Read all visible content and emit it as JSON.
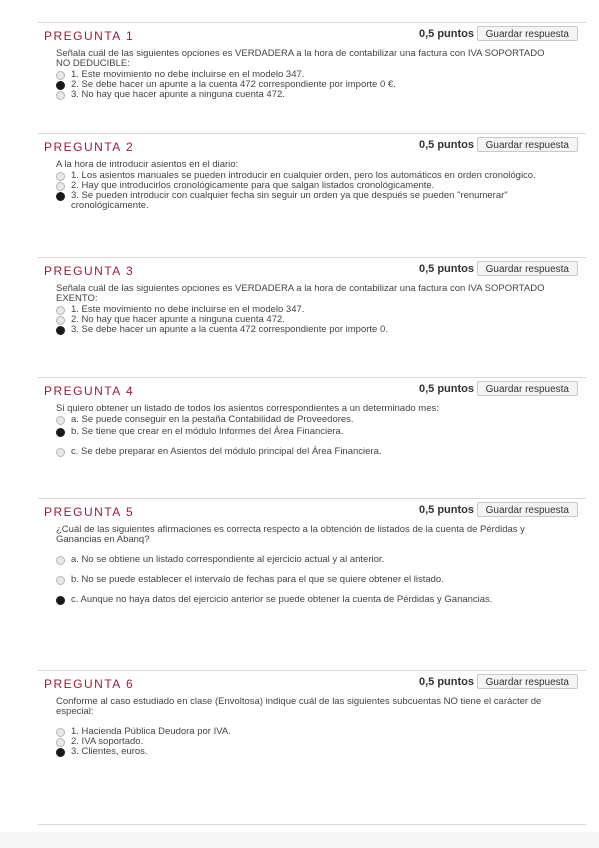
{
  "save_label": "Guardar respuesta",
  "questions": [
    {
      "title": "PREGUNTA 1",
      "points": "0,5 puntos",
      "text": "Señala cuál de las siguientes opciones es VERDADERA a la hora de contabilizar una factura con IVA SOPORTADO NO DEDUCIBLE:",
      "options": [
        {
          "label": "1. Este movimiento no debe incluirse en el modelo 347.",
          "selected": false
        },
        {
          "label": "2. Se debe hacer un apunte a la cuenta 472 correspondiente por importe 0 €.",
          "selected": true
        },
        {
          "label": "3. No hay que hacer apunte a ninguna cuenta 472.",
          "selected": false
        }
      ]
    },
    {
      "title": "PREGUNTA 2",
      "points": "0,5 puntos",
      "text": "A la hora de introducir asientos en el diario:",
      "options": [
        {
          "label": "1. Los asientos manuales se pueden introducir en cualquier orden, pero los automáticos en orden cronológico.",
          "selected": false
        },
        {
          "label": "2. Hay que introducirlos cronológicamente para que salgan listados cronológicamente.",
          "selected": false
        },
        {
          "label": "3. Se pueden introducir con cualquier fecha sin seguir un orden ya que después se pueden \"renumerar\" cronológicamente.",
          "selected": true
        }
      ]
    },
    {
      "title": "PREGUNTA 3",
      "points": "0,5 puntos",
      "text": "Señala cuál de las siguientes opciones es VERDADERA a la hora de contabilizar una factura con IVA SOPORTADO EXENTO:",
      "options": [
        {
          "label": "1. Este movimiento no debe incluirse en el modelo 347.",
          "selected": false
        },
        {
          "label": "2. No hay que hacer apunte a ninguna cuenta 472.",
          "selected": false
        },
        {
          "label": "3. Se debe hacer un apunte a la cuenta 472 correspondiente por importe 0.",
          "selected": true
        }
      ]
    },
    {
      "title": "PREGUNTA 4",
      "points": "0,5 puntos",
      "text": "Si quiero obtener un listado de todos los asientos correspondientes a un determinado mes:",
      "options": [
        {
          "label": "a. Se puede conseguir en la pestaña Contabilidad de Proveedores.",
          "selected": false
        },
        {
          "label": "b. Se tiene que crear en el módulo Informes del Área Financiera.",
          "selected": true
        },
        {
          "label": "c. Se debe preparar en Asientos del módulo principal del Área Financiera.",
          "selected": false
        }
      ]
    },
    {
      "title": "PREGUNTA 5",
      "points": "0,5 puntos",
      "text": "¿Cuál de las siguientes afirmaciones es correcta respecto a la obtención de listados de la cuenta de Pérdidas y Ganancias en Abanq?",
      "options": [
        {
          "label": "a. No se obtiene un listado correspondiente al ejercicio actual y al anterior.",
          "selected": false
        },
        {
          "label": "b. No se puede establecer el intervalo de fechas para el que se quiere obtener el listado.",
          "selected": false
        },
        {
          "label": "c. Aunque no haya datos del ejercicio anterior se puede obtener la cuenta de Pérdidas y Ganancias.",
          "selected": true
        }
      ]
    },
    {
      "title": "PREGUNTA 6",
      "points": "0,5 puntos",
      "text": "Conforme al caso estudiado en clase (Envoltosa) indique cuál de las siguientes subcuentas NO tiene el carácter de especial:",
      "options": [
        {
          "label": "1. Hacienda Pública Deudora por IVA.",
          "selected": false
        },
        {
          "label": "2. IVA soportado.",
          "selected": false
        },
        {
          "label": "3. Clientes, euros.",
          "selected": true
        }
      ]
    }
  ]
}
